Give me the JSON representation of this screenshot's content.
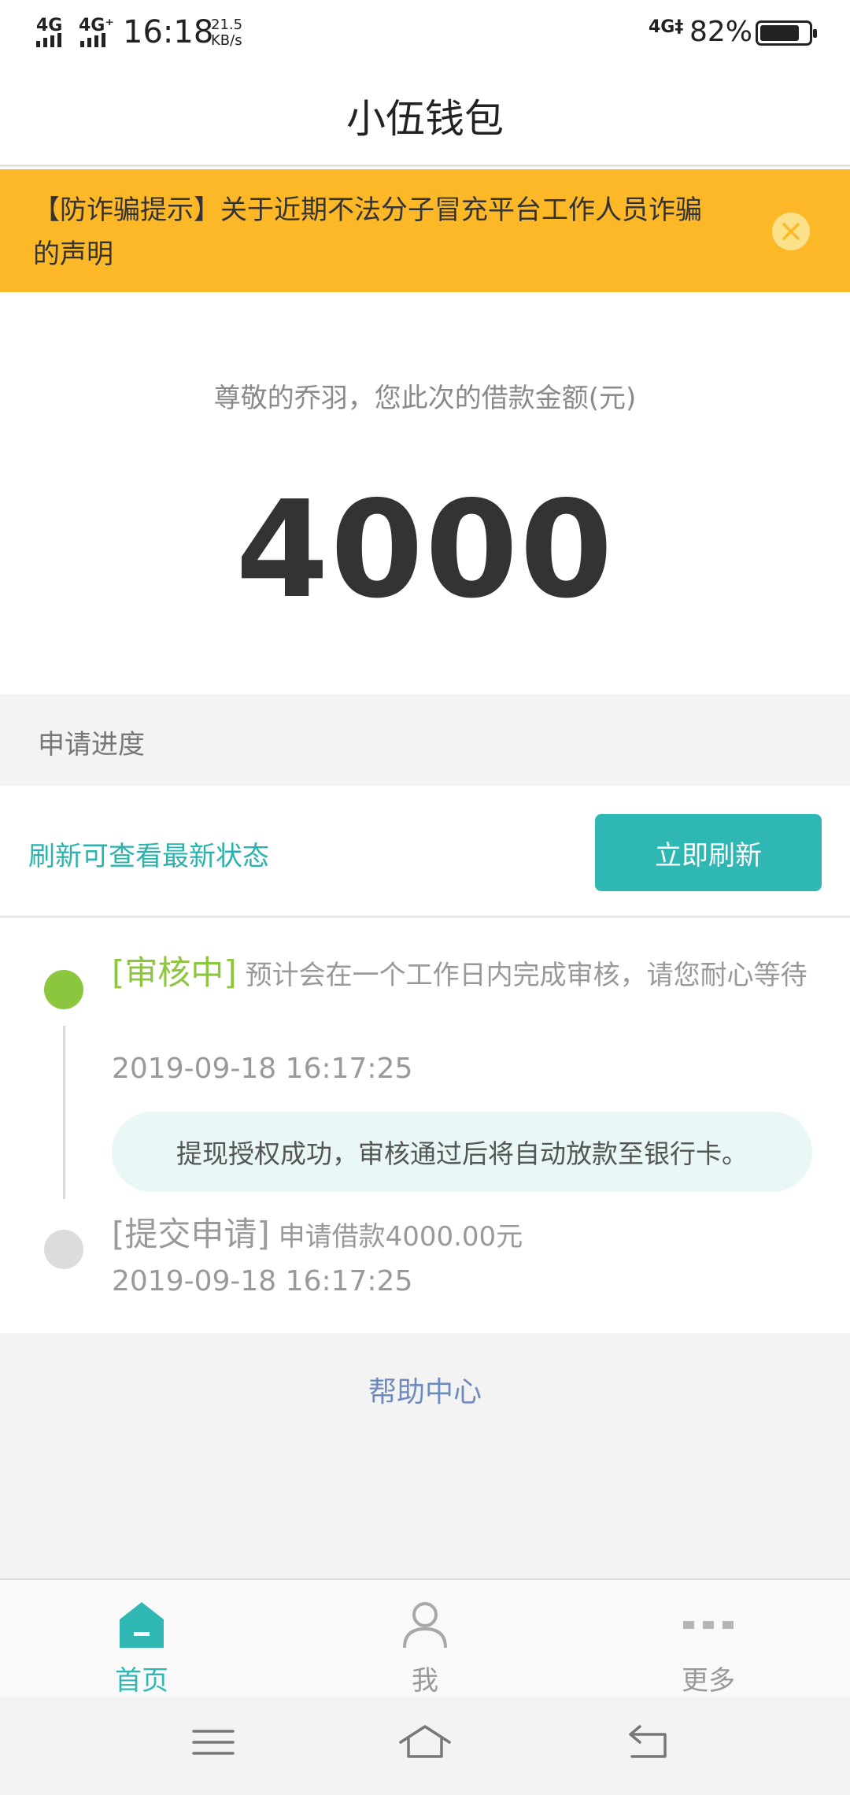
{
  "status_bar": {
    "signal_left_1": "4G",
    "signal_left_2": "4G⁺",
    "time": "16:18",
    "speed_value": "21.5",
    "speed_unit": "KB/s",
    "signal_right": "4G‡",
    "battery_text": "82%",
    "battery_level": 0.82
  },
  "header": {
    "title": "小伍钱包"
  },
  "notice": {
    "text": "【防诈骗提示】关于近期不法分子冒充平台工作人员诈骗的声明",
    "close_icon": "close-icon",
    "background_color": "#fdb827"
  },
  "loan": {
    "label": "尊敬的乔羽，您此次的借款金额(元)",
    "amount": "4000"
  },
  "progress": {
    "section_title": "申请进度",
    "refresh_hint": "刷新可查看最新状态",
    "refresh_button": "立即刷新",
    "accent_color": "#2fb8b3",
    "steps": [
      {
        "status": "[审核中]",
        "description": "预计会在一个工作日内完成审核，请您耐心等待",
        "time": "2019-09-18 16:17:25",
        "note": "提现授权成功，审核通过后将自动放款至银行卡。",
        "dot_color": "#8cc63f"
      },
      {
        "status": "[提交申请]",
        "description": "申请借款4000.00元",
        "time": "2019-09-18 16:17:25",
        "dot_color": "#dcdcdc"
      }
    ]
  },
  "help": {
    "label": "帮助中心"
  },
  "tabbar": {
    "items": [
      {
        "label": "首页",
        "icon": "home-icon",
        "active": true
      },
      {
        "label": "我",
        "icon": "person-icon",
        "active": false
      },
      {
        "label": "更多",
        "icon": "more-icon",
        "active": false
      }
    ]
  },
  "navbar": {
    "menu_icon": "menu-icon",
    "home_icon": "home-nav-icon",
    "back_icon": "back-icon"
  }
}
